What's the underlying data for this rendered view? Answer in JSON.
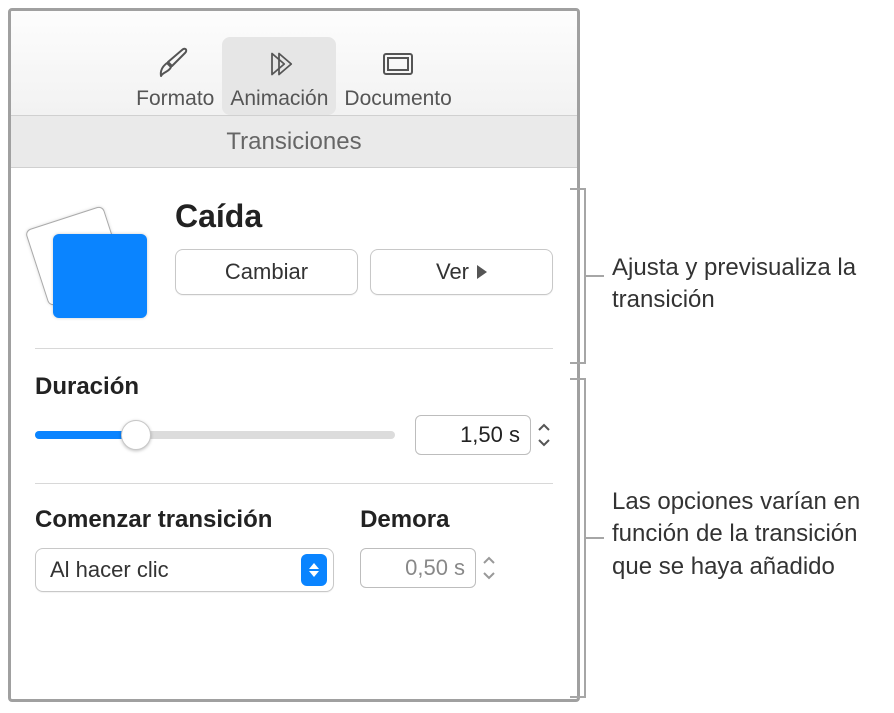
{
  "tabs": {
    "format": "Formato",
    "animation": "Animación",
    "document": "Documento"
  },
  "subheader": "Transiciones",
  "transition": {
    "name": "Caída",
    "change_label": "Cambiar",
    "preview_label": "Ver"
  },
  "duration": {
    "label": "Duración",
    "value": "1,50 s"
  },
  "start": {
    "label": "Comenzar transición",
    "selected": "Al hacer clic"
  },
  "delay": {
    "label": "Demora",
    "value": "0,50 s"
  },
  "callouts": {
    "top": "Ajusta y previsualiza la transición",
    "bottom": "Las opciones varían en función de la transición que se haya añadido"
  }
}
